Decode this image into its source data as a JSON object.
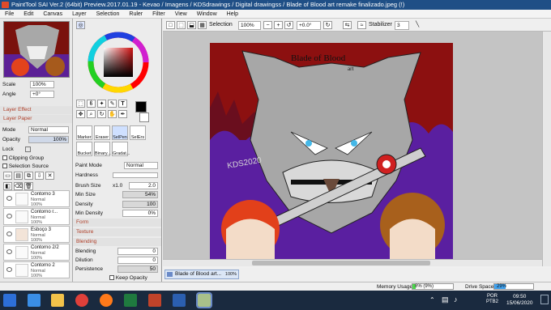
{
  "window": {
    "title": "PaintTool SAI Ver.2 (64bit) Preview.2017.01.19 - Kevao / Imagens / KDSdrawings / Digital drawingss / Blade of Blood art remake finalizado.jpeg (!)"
  },
  "menu": [
    "File",
    "Edit",
    "Canvas",
    "Layer",
    "Selection",
    "Ruler",
    "Filter",
    "View",
    "Window",
    "Help"
  ],
  "navigator": {
    "scale_label": "Scale",
    "scale_value": "100%",
    "angle_label": "Angle",
    "angle_value": "+0°"
  },
  "layer_panel": {
    "layer_effect": "Layer Effect",
    "layer_paper": "Layer Paper",
    "mode_label": "Mode",
    "mode_value": "Normal",
    "opacity_label": "Opacity",
    "opacity_value": "100%",
    "lock_label": "Lock",
    "clipping_group": "Clipping Group",
    "selection_source": "Selection Source",
    "layers": [
      {
        "name": "Contorno 3",
        "mode": "Normal",
        "opacity": "100%"
      },
      {
        "name": "Contorno r...",
        "mode": "Normal",
        "opacity": "100%"
      },
      {
        "name": "Esboço 3",
        "mode": "Normal",
        "opacity": "100%"
      },
      {
        "name": "Contorno 2/2",
        "mode": "Normal",
        "opacity": "100%"
      },
      {
        "name": "Contorno 2",
        "mode": "Normal",
        "opacity": "100%"
      }
    ]
  },
  "brush_tools": [
    "Marker",
    "Eraser",
    "SelPen",
    "SelErs",
    "Bucket",
    "Binary...",
    "Gradat..."
  ],
  "brush_settings": {
    "paint_mode_label": "Paint Mode",
    "paint_mode_value": "Normal",
    "hardness_label": "Hardness",
    "brush_size_label": "Brush Size",
    "brush_size_mult": "x1.0",
    "brush_size_value": "2.0",
    "min_size_label": "Min Size",
    "min_size_value": "54%",
    "density_label": "Density",
    "density_value": "100",
    "min_density_label": "Min Density",
    "min_density_value": "0%",
    "form_label": "Form",
    "texture_label": "Texture",
    "blending_section": "Blending",
    "blending_label": "Blending",
    "blending_value": "0",
    "dilution_label": "Dilution",
    "dilution_value": "0",
    "persistence_label": "Persistence",
    "persistence_value": "50",
    "keep_opacity": "Keep Opacity"
  },
  "toolbar": {
    "selection_label": "Selection",
    "zoom_value": "100%",
    "angle_value": "+0.0°",
    "stabilizer_label": "Stabilizer",
    "stabilizer_value": "3"
  },
  "artwork": {
    "title_text": "Blade of Blood",
    "subtitle_text": "art",
    "signature": "KDS2020"
  },
  "document_tab": {
    "name": "Blade of Blood art...",
    "zoom": "100%"
  },
  "status": {
    "memory_label": "Memory Usage",
    "memory_value": "8% (9%)",
    "memory_fraction": 0.08,
    "drive_label": "Drive Space",
    "drive_value": "29%",
    "drive_fraction": 0.29
  },
  "taskbar": {
    "lang_top": "POR",
    "lang_bottom": "PTB2",
    "time": "09:50",
    "date": "15/06/2020"
  },
  "colors": {
    "titlebar": "#1f4f86",
    "canvas_red": "#8c1010",
    "canvas_purple": "#5a1fa0",
    "accent_section": "#b0402a",
    "taskbar": "#1a2a3f"
  }
}
